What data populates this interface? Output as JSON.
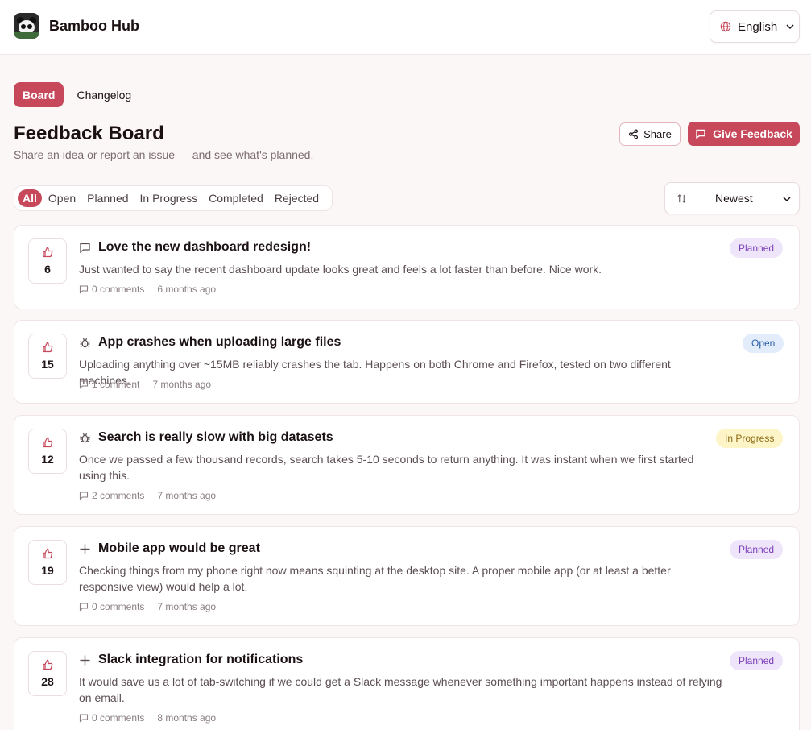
{
  "app": {
    "name": "Bamboo Hub"
  },
  "language": {
    "selected": "English"
  },
  "nav": {
    "tabs": [
      {
        "label": "Board"
      },
      {
        "label": "Changelog"
      }
    ]
  },
  "header": {
    "title": "Feedback Board",
    "subtitle": "Share an idea or report an issue — and see what's planned.",
    "share_label": "Share",
    "give_feedback_label": "Give Feedback"
  },
  "filters": [
    {
      "label": "All",
      "active": true
    },
    {
      "label": "Open"
    },
    {
      "label": "Planned"
    },
    {
      "label": "In Progress"
    },
    {
      "label": "Completed"
    },
    {
      "label": "Rejected"
    }
  ],
  "sort": {
    "selected": "Newest"
  },
  "colors": {
    "accent": "#c7485b",
    "background": "#fcf7f7"
  },
  "posts": [
    {
      "votes": "6",
      "type_icon": "message-icon",
      "title": "Love the new dashboard redesign!",
      "description": "Just wanted to say the recent dashboard update looks great and feels a lot faster than before. Nice work.",
      "comments": "0 comments",
      "time": "6 months ago",
      "status": "Planned"
    },
    {
      "votes": "15",
      "type_icon": "bug-icon",
      "title": "App crashes when uploading large files",
      "description": "Uploading anything over ~15MB reliably crashes the tab. Happens on both Chrome and Firefox, tested on two different machines.",
      "comments": "1 comment",
      "time": "7 months ago",
      "status": "Open"
    },
    {
      "votes": "12",
      "type_icon": "bug-icon",
      "title": "Search is really slow with big datasets",
      "description": "Once we passed a few thousand records, search takes 5-10 seconds to return anything. It was instant when we first started using this.",
      "comments": "2 comments",
      "time": "7 months ago",
      "status": "In Progress"
    },
    {
      "votes": "19",
      "type_icon": "plus-icon",
      "title": "Mobile app would be great",
      "description": "Checking things from my phone right now means squinting at the desktop site. A proper mobile app (or at least a better responsive view) would help a lot.",
      "comments": "0 comments",
      "time": "7 months ago",
      "status": "Planned"
    },
    {
      "votes": "28",
      "type_icon": "plus-icon",
      "title": "Slack integration for notifications",
      "description": "It would save us a lot of tab-switching if we could get a Slack message whenever something important happens instead of relying on email.",
      "comments": "0 comments",
      "time": "8 months ago",
      "status": "Planned"
    }
  ]
}
